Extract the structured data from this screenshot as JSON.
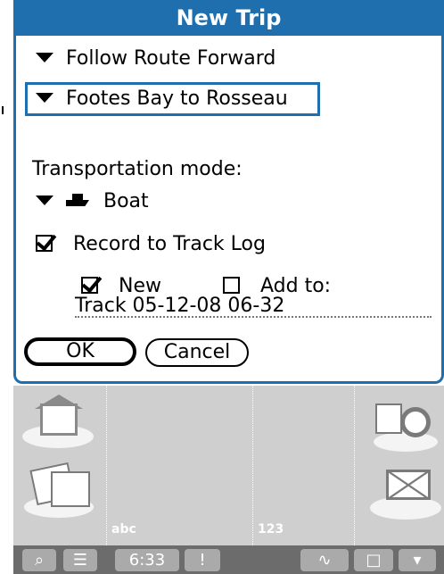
{
  "dialog": {
    "title": "New Trip",
    "mode_option": "Follow Route Forward",
    "route": "Footes Bay to Rosseau",
    "transport_label": "Transportation mode:",
    "transport_value": "Boat",
    "record_label": "Record to Track Log",
    "record_checked": true,
    "new_label": "New",
    "new_checked": true,
    "addto_label": "Add to:",
    "addto_checked": false,
    "track_name": "Track 05-12-08 06-32",
    "ok_label": "OK",
    "cancel_label": "Cancel",
    "accent_color": "#1f6fae"
  },
  "launcher": {
    "left_label": "abc",
    "right_label": "123",
    "icons": [
      "home-icon",
      "media-icon",
      "sync-icon",
      "mail-icon"
    ]
  },
  "statusbar": {
    "time": "6:33",
    "icons": [
      "find-icon",
      "menu-icon",
      "alert-icon",
      "graffiti-icon",
      "input-icon",
      "hide-icon"
    ]
  }
}
